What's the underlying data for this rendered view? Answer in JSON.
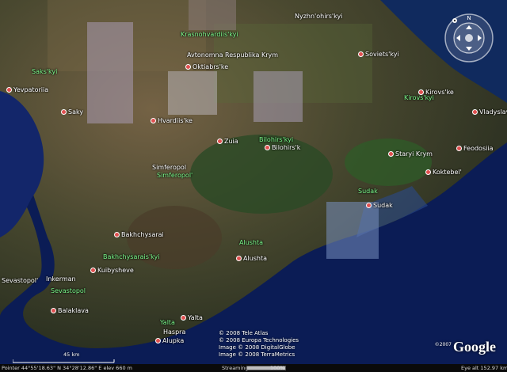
{
  "places": {
    "nyzhn_ohirs": "Nyzhn'ohirs'kyi",
    "krasnohvardiis": "Krasnohvardiis'kyi",
    "avtonomna": "Avtonomna Respublika Krym",
    "oktiabrs": "Oktiabrs'ke",
    "soviets": "Soviets'kyi",
    "sakskyi": "Saks'kyi",
    "yevpatoriia": "Yevpatoriia",
    "kirovs_region": "Kirovs'kyi",
    "kirovske": "Kirovs'ke",
    "vladyslavivka": "Vladyslavivka",
    "saky": "Saky",
    "hvardiiske": "Hvardiis'ke",
    "zuia": "Zuia",
    "bilohirs_region": "Bilohirs'kyi",
    "bilohirsk": "Bilohirs'k",
    "staryi_krym": "Staryi Krym",
    "feodosiia": "Feodosiia",
    "simferopol": "Simferopol",
    "simferopol_region": "Simferopol'",
    "koktebel": "Koktebel'",
    "sudak_region": "Sudak",
    "sudak": "Sudak",
    "bakhchysarai": "Bakhchysarai",
    "alushta_region": "Alushta",
    "alushta": "Alushta",
    "bakhchysarais_region": "Bakhchysarais'kyi",
    "sevastopol": "Sevastopol'",
    "inkerman": "Inkerman",
    "kuibysheve": "Kuibysheve",
    "sevastopol_region": "Sevastopol",
    "balaklava": "Balaklava",
    "yalta_region": "Yalta",
    "yalta": "Yalta",
    "haspra": "Haspra",
    "alupka": "Alupka"
  },
  "credits": {
    "line1": "© 2008 Tele Atlas",
    "line2": "© 2008 Europa Technologies",
    "line3": "Image © 2008 DigitalGlobe",
    "line4": "Image © 2008 TerraMetrics"
  },
  "brand": {
    "copyright": "©2007",
    "logo": "Google"
  },
  "scale": {
    "label": "45 km"
  },
  "status": {
    "pointer": "Pointer  44°55'18.63\" N   34°28'12.86\" E   elev  660 m",
    "streaming_label": "Streaming",
    "streaming_pct": "100%",
    "streaming_fraction": 1.0,
    "eye_alt": "Eye alt   152.97 km"
  }
}
